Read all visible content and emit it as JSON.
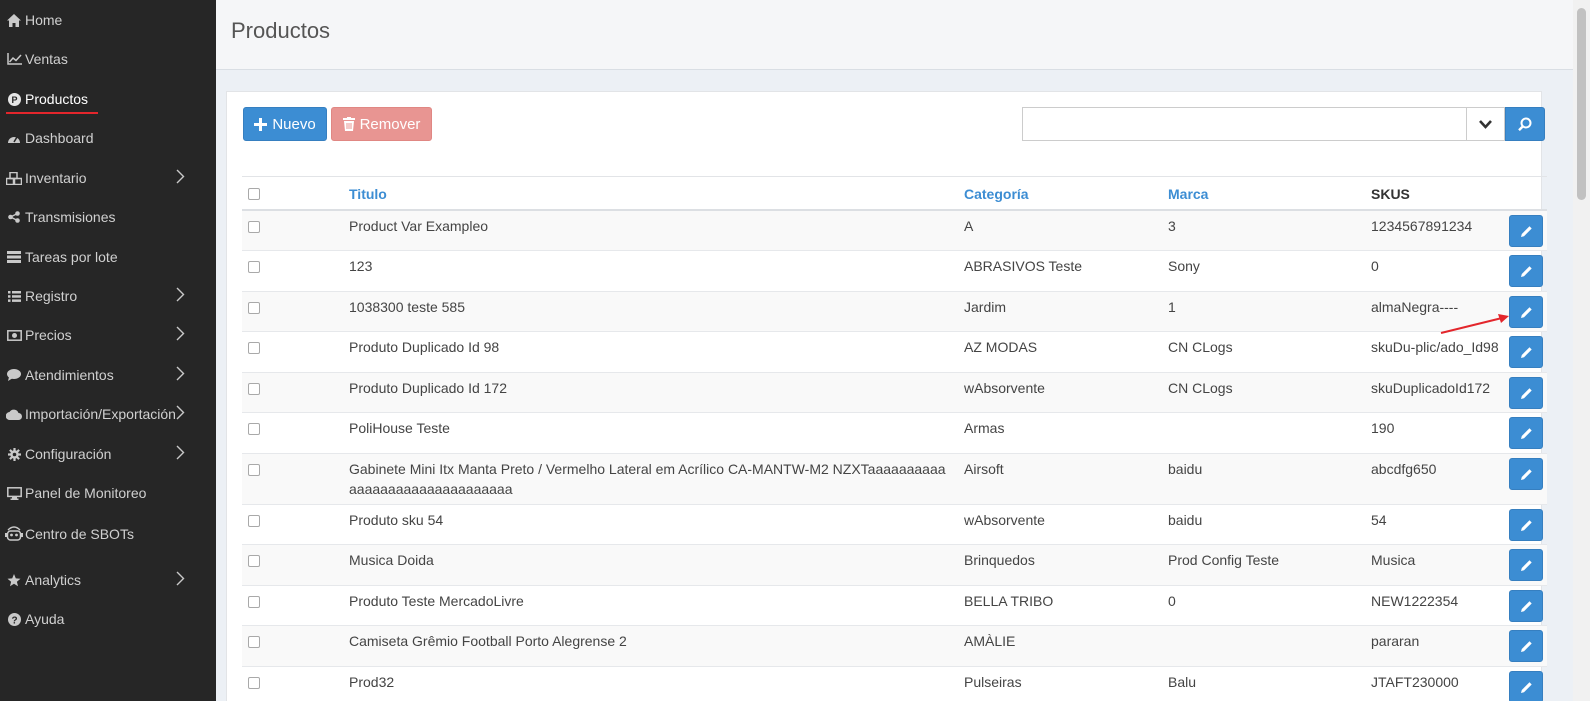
{
  "sidebar": {
    "items": [
      {
        "label": "Home",
        "icon": "home-icon"
      },
      {
        "label": "Ventas",
        "icon": "chart-line-icon"
      },
      {
        "label": "Productos",
        "icon": "product-circle-icon"
      },
      {
        "label": "Dashboard",
        "icon": "dashboard-icon"
      },
      {
        "label": "Inventario",
        "icon": "cubes-icon"
      },
      {
        "label": "Transmisiones",
        "icon": "share-icon"
      },
      {
        "label": "Tareas por lote",
        "icon": "tasks-icon"
      },
      {
        "label": "Registro",
        "icon": "list-icon"
      },
      {
        "label": "Precios",
        "icon": "money-icon"
      },
      {
        "label": "Atendimientos",
        "icon": "comment-icon"
      },
      {
        "label": "Importación/Exportación",
        "icon": "cloud-icon"
      },
      {
        "label": "Configuración",
        "icon": "gear-icon"
      },
      {
        "label": "Panel de Monitoreo",
        "icon": "desktop-icon"
      },
      {
        "label": "Centro de SBOTs",
        "icon": "robot-icon"
      },
      {
        "label": "Analytics",
        "icon": "star-icon"
      },
      {
        "label": "Ayuda",
        "icon": "question-circle-icon"
      }
    ],
    "active": "Productos",
    "accent_color": "#e3262c"
  },
  "header": {
    "title": "Productos"
  },
  "toolbar": {
    "new_label": "Nuevo",
    "remove_label": "Remover",
    "search_value": "",
    "primary_color": "#3c8dd3",
    "danger_color": "#e89592"
  },
  "table": {
    "columns": {
      "title": "Titulo",
      "category": "Categoría",
      "brand": "Marca",
      "skus": "SKUS"
    },
    "rows": [
      {
        "title": "Product Var Exampleo",
        "category": "A",
        "brand": "3",
        "sku": "1234567891234"
      },
      {
        "title": "123",
        "category": "ABRASIVOS Teste",
        "brand": "Sony",
        "sku": "0"
      },
      {
        "title": "1038300 teste 585",
        "category": "Jardim",
        "brand": "1",
        "sku": "almaNegra----"
      },
      {
        "title": "Produto Duplicado Id 98",
        "category": "AZ MODAS",
        "brand": "CN CLogs",
        "sku": "skuDu-plic/ado_Id98"
      },
      {
        "title": "Produto Duplicado Id 172",
        "category": "wAbsorvente",
        "brand": "CN CLogs",
        "sku": "skuDuplicadoId172"
      },
      {
        "title": "PoliHouse Teste",
        "category": "Armas",
        "brand": "",
        "sku": "190"
      },
      {
        "title": "Gabinete Mini Itx Manta Preto / Vermelho Lateral em Acrílico CA-MANTW-M2 NZXTaaaaaaaaaaaaaaaaaaaaaaaaaaaaaaa",
        "category": "Airsoft",
        "brand": "baidu",
        "sku": "abcdfg650"
      },
      {
        "title": "Produto sku 54",
        "category": "wAbsorvente",
        "brand": "baidu",
        "sku": "54"
      },
      {
        "title": "Musica Doida",
        "category": "Brinquedos",
        "brand": "Prod Config Teste",
        "sku": "Musica"
      },
      {
        "title": "Produto Teste MercadoLivre",
        "category": "BELLA TRIBO",
        "brand": "0",
        "sku": "NEW1222354"
      },
      {
        "title": "Camiseta Grêmio Football Porto Alegrense 2",
        "category": "AMÀLIE",
        "brand": "",
        "sku": "pararan"
      },
      {
        "title": "Prod32",
        "category": "Pulseiras",
        "brand": "Balu",
        "sku": "JTAFT230000"
      }
    ]
  }
}
